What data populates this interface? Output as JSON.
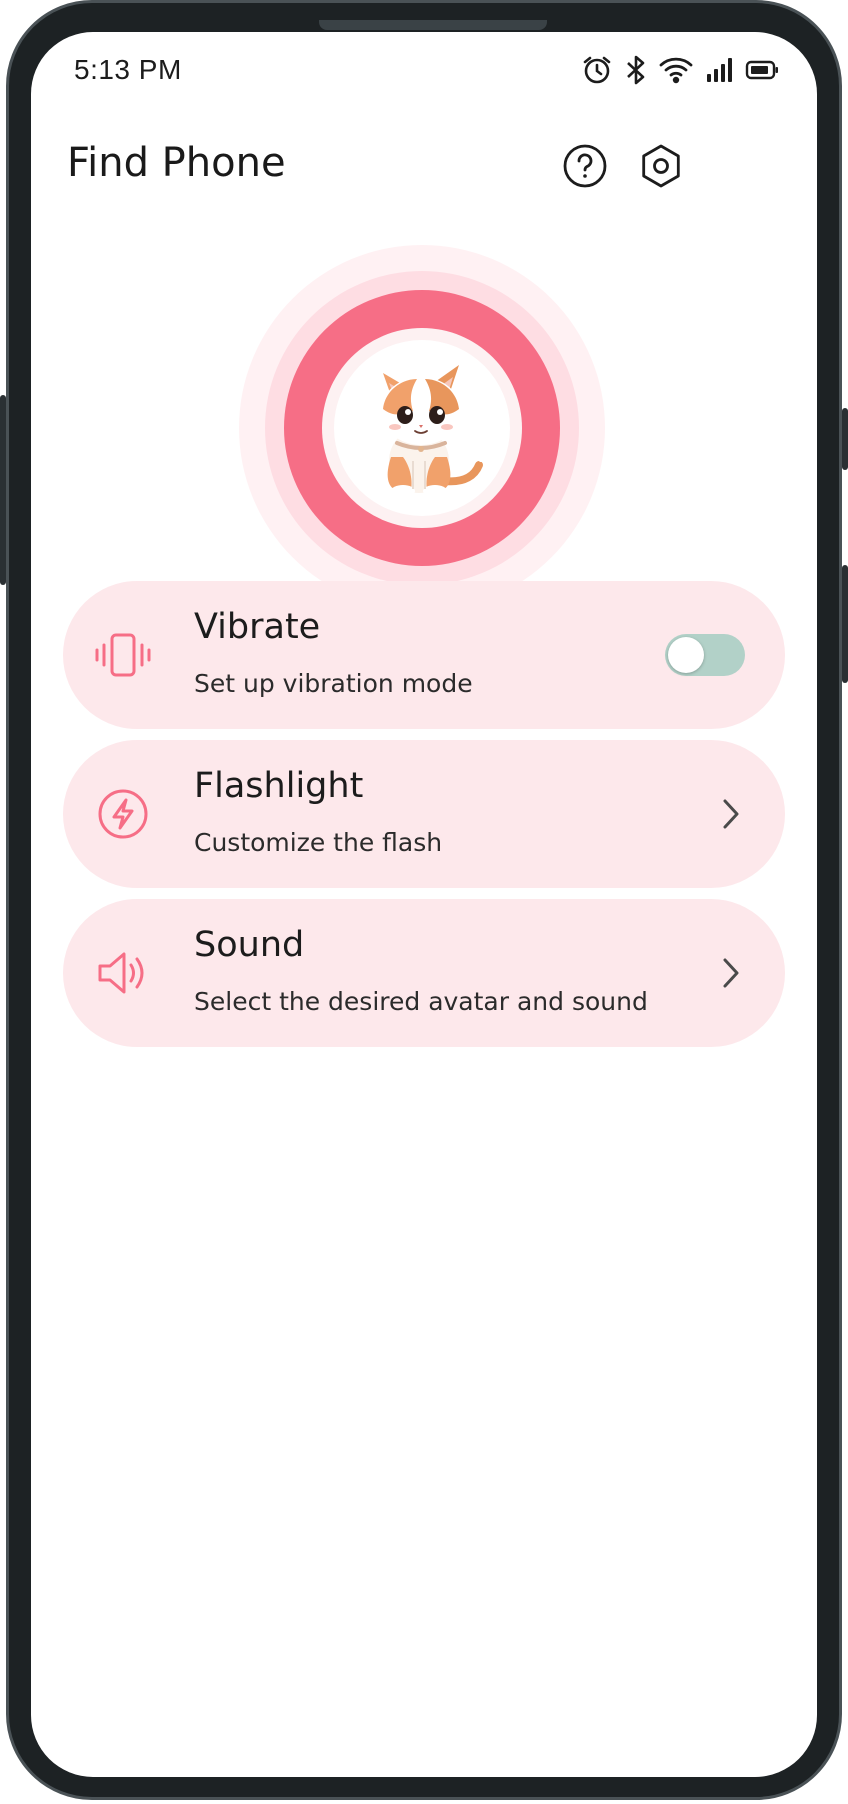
{
  "status_bar": {
    "time": "5:13 PM",
    "icons": [
      "alarm-icon",
      "bluetooth-icon",
      "wifi-icon",
      "signal-icon",
      "battery-icon"
    ]
  },
  "header": {
    "title": "Find Phone",
    "help_icon": "help-icon",
    "settings_icon": "settings-icon"
  },
  "hero": {
    "avatar": "cat-avatar"
  },
  "options": [
    {
      "title": "Vibrate",
      "subtitle": "Set up vibration mode",
      "icon": "vibrate-icon",
      "control": "toggle",
      "enabled": false
    },
    {
      "title": "Flashlight",
      "subtitle": "Customize the flash",
      "icon": "flash-icon",
      "control": "chevron"
    },
    {
      "title": "Sound",
      "subtitle": "Select the desired avatar and sound",
      "icon": "speaker-icon",
      "control": "chevron"
    }
  ],
  "colors": {
    "accent": "#f66e86",
    "card_bg": "#fde8eb",
    "toggle_off": "#b2d1c8",
    "text": "#1c1c1c"
  }
}
